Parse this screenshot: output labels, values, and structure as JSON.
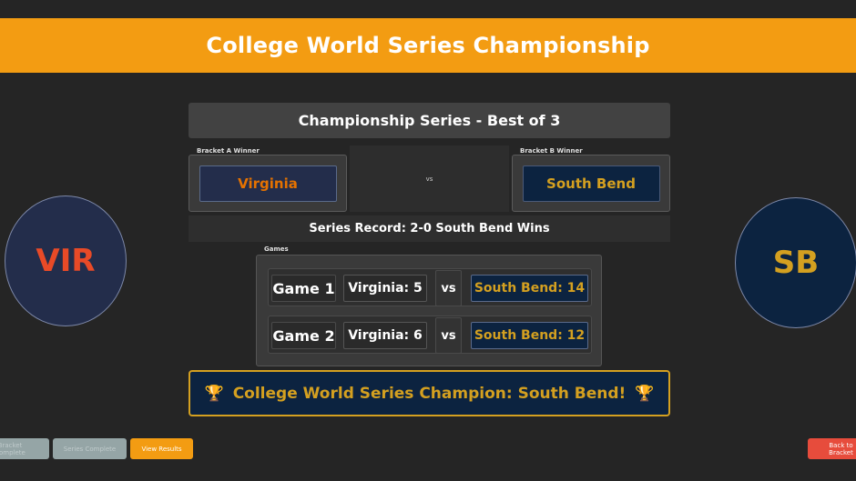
{
  "page": {
    "title": "College World Series Championship",
    "accent_color": "#f39c12"
  },
  "series": {
    "header": "Championship Series - Best of 3",
    "record": "Series Record: 2-0 South Bend Wins",
    "vs_text": "vs"
  },
  "bracket_a": {
    "label": "Bracket A Winner",
    "team": "Virginia",
    "abbrev": "VIR",
    "colors": {
      "background": "#232d4b",
      "text": "#e57200"
    }
  },
  "bracket_b": {
    "label": "Bracket B Winner",
    "team": "South Bend",
    "abbrev": "SB",
    "colors": {
      "background": "#0c2340",
      "text": "#d4a020"
    }
  },
  "games": {
    "label": "Games",
    "rows": [
      {
        "game": "Game 1",
        "home": "Virginia: 5",
        "vs": "vs",
        "away": "South Bend: 14"
      },
      {
        "game": "Game 2",
        "home": "Virginia: 6",
        "vs": "vs",
        "away": "South Bend: 12"
      }
    ]
  },
  "champion": {
    "text": "College World Series Champion: South Bend!",
    "icon": "trophy-icon",
    "glyph": "🏆"
  },
  "buttons": {
    "bracket_complete": "Bracket Complete",
    "series_complete": "Series Complete",
    "view_results": "View Results",
    "back": "Back to Bracket"
  }
}
